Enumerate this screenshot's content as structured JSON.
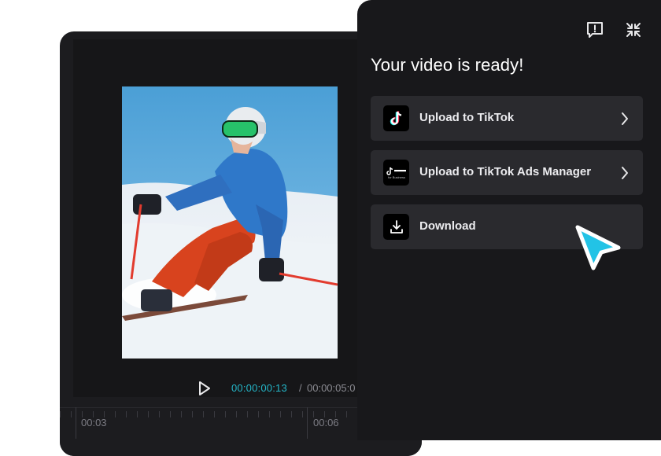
{
  "editor": {
    "time_current": "00:00:00:13",
    "time_separator": "/",
    "time_total": "00:00:05:0",
    "ruler_labels": [
      "00:03",
      "00:06"
    ]
  },
  "panel": {
    "title": "Your video is ready!",
    "header_icons": [
      "feedback-icon",
      "collapse-icon"
    ],
    "options": [
      {
        "label": "Upload to TikTok",
        "icon": "tiktok-icon",
        "has_chevron": true
      },
      {
        "label": "Upload to TikTok Ads Manager",
        "icon": "tiktok-ads-icon",
        "has_chevron": true,
        "icon_caption": "for Business"
      },
      {
        "label": "Download",
        "icon": "download-icon",
        "has_chevron": false
      }
    ]
  },
  "colors": {
    "accent": "#24b7c9",
    "panel_bg": "#18181b",
    "option_bg": "#2a2a2e",
    "cursor": "#22c3e6"
  }
}
